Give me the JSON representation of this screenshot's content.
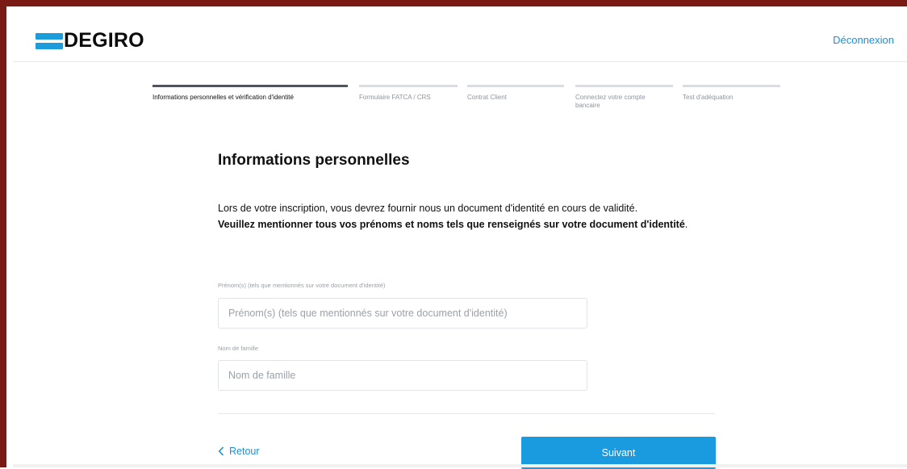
{
  "brand": {
    "name": "DEGIRO",
    "accent": "#1b9ddc",
    "frame_color": "#7a1a14"
  },
  "header": {
    "logout_label": "Déconnexion"
  },
  "steps": [
    {
      "label": "Informations personnelles et vérification d'identité",
      "active": true
    },
    {
      "label": "Formulaire FATCA / CRS",
      "active": false
    },
    {
      "label": "Contrat Client",
      "active": false
    },
    {
      "label": "Connectez votre compte bancaire",
      "active": false
    },
    {
      "label": "Test d'adéquation",
      "active": false
    }
  ],
  "main": {
    "title": "Informations personnelles",
    "intro": "Lors de votre inscription, vous devrez fournir nous un document d'identité en cours de validité.",
    "intro_bold": "Veuillez mentionner tous vos prénoms et noms tels que renseignés sur votre document d'identité",
    "intro_end": "."
  },
  "form": {
    "first_name": {
      "label": "Prénom(s) (tels que mentionnés sur votre document d'identité)",
      "placeholder": "Prénom(s) (tels que mentionnés sur votre document d'identité)",
      "value": ""
    },
    "last_name": {
      "label": "Nom de famille",
      "placeholder": "Nom de famille",
      "value": ""
    }
  },
  "footer": {
    "back_label": "Retour",
    "next_label": "Suivant"
  }
}
